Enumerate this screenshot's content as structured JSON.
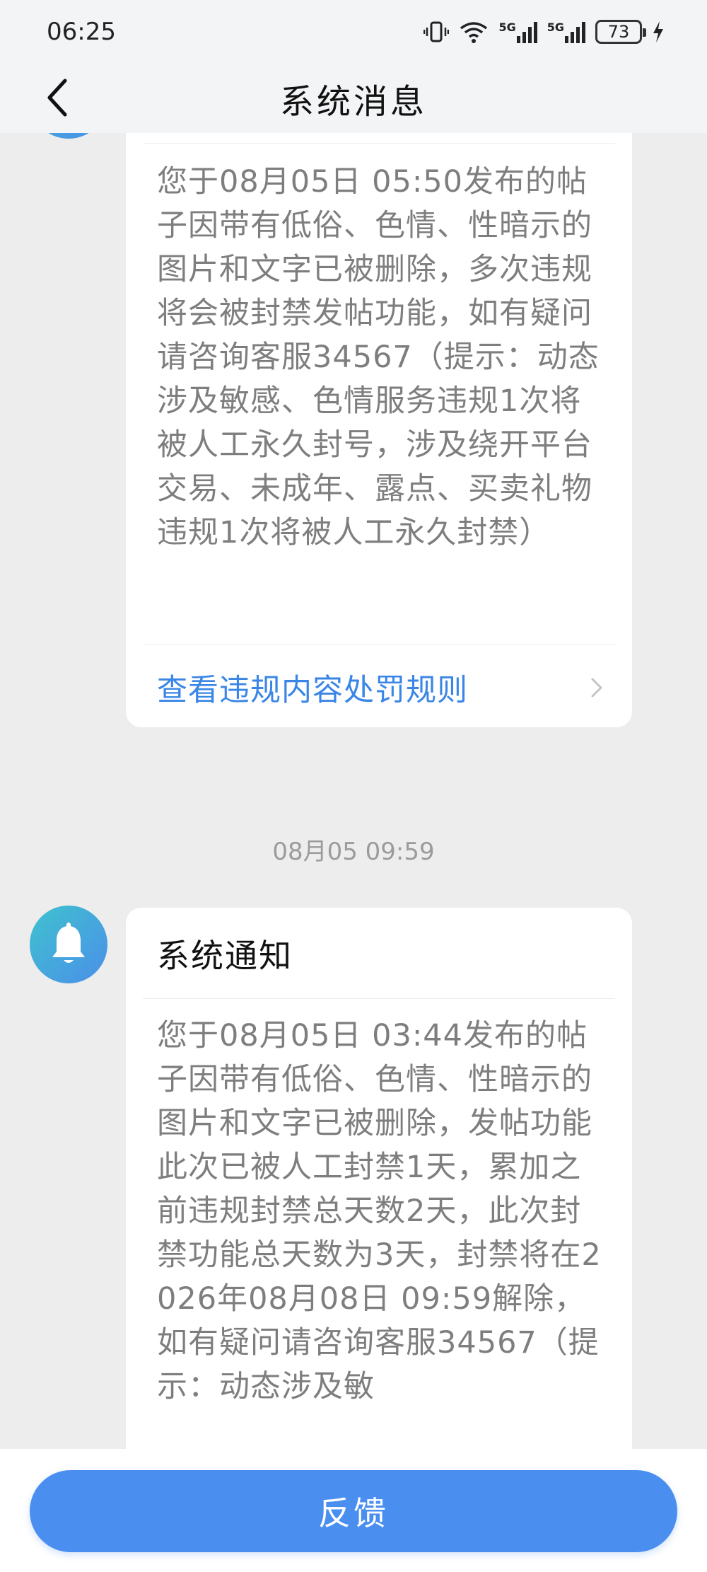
{
  "status_bar": {
    "time": "06:25",
    "signal1_label": "5G",
    "signal2_label": "5G",
    "battery": "73",
    "icons": [
      "vibrate-icon",
      "wifi-icon",
      "signal-5g-icon",
      "signal-5g-icon",
      "battery-icon",
      "charging-icon"
    ]
  },
  "header": {
    "title": "系统消息",
    "back_icon": "chevron-left-icon"
  },
  "messages": [
    {
      "body": "您于08月05日 05:50发布的帖子因带有低俗、色情、性暗示的图片和文字已被删除，多次违规将会被封禁发帖功能，如有疑问请咨询客服34567（提示：动态涉及敏感、色情服务违规1次将被人工永久封号，涉及绕开平台交易、未成年、露点、买卖礼物违规1次将被人工永久封禁）",
      "link_label": "查看违规内容处罚规则"
    },
    {
      "timestamp": "08月05 09:59",
      "title": "系统通知",
      "avatar_icon": "bell-icon",
      "body": "您于08月05日 03:44发布的帖子因带有低俗、色情、性暗示的图片和文字已被删除，发帖功能此次已被人工封禁1天，累加之前违规封禁总天数2天，此次封禁功能总天数为3天，封禁将在2026年08月08日 09:59解除，如有疑问请咨询客服34567（提示：动态涉及敏"
    }
  ],
  "footer": {
    "feedback_label": "反馈"
  }
}
